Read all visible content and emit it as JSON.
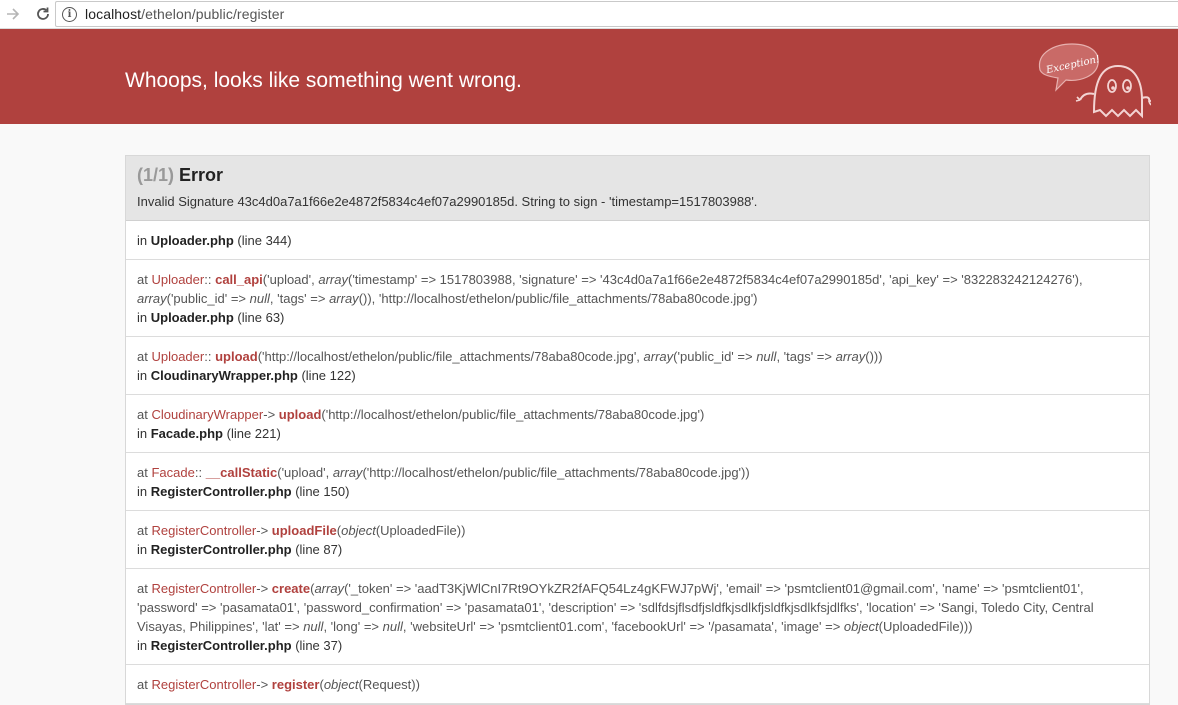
{
  "browser": {
    "url_host": "localhost",
    "url_path": "/ethelon/public/register"
  },
  "header": {
    "title": "Whoops, looks like something went wrong.",
    "logo_text": "Exception!"
  },
  "exception": {
    "count": "(1/1)",
    "type": "Error",
    "message": "Invalid Signature 43c4d0a7a1f66e2e4872f5834c4ef07a2990185d. String to sign - 'timestamp=1517803988'."
  },
  "trace": [
    {
      "file": "Uploader.php",
      "line": "(line 344)"
    },
    {
      "file": "Uploader.php",
      "line": "(line 63)"
    },
    {
      "file": "CloudinaryWrapper.php",
      "line": "(line 122)"
    },
    {
      "file": "Facade.php",
      "line": "(line 221)"
    },
    {
      "file": "RegisterController.php",
      "line": "(line 150)"
    },
    {
      "file": "RegisterController.php",
      "line": "(line 87)"
    },
    {
      "file": "RegisterController.php",
      "line": "(line 37)"
    }
  ],
  "calls": {
    "c1": {
      "cls": "Uploader",
      "sep": "::",
      "fn": "call_api"
    },
    "c2": {
      "cls": "Uploader",
      "sep": "::",
      "fn": "upload"
    },
    "c3": {
      "cls": "CloudinaryWrapper",
      "sep": "->",
      "fn": "upload"
    },
    "c4": {
      "cls": "Facade",
      "sep": "::",
      "fn": "__callStatic"
    },
    "c5": {
      "cls": "RegisterController",
      "sep": "->",
      "fn": "uploadFile"
    },
    "c6": {
      "cls": "RegisterController",
      "sep": "->",
      "fn": "create"
    },
    "c7": {
      "cls": "RegisterController",
      "sep": "->",
      "fn": "register"
    }
  },
  "args": {
    "c1a": "('upload', ",
    "c1b": "('timestamp' => 1517803988, 'signature' => '43c4d0a7a1f66e2e4872f5834c4ef07a2990185d', 'api_key' => '832283242124276'), ",
    "c1c": "('public_id' => ",
    "c1d": ", 'tags' => ",
    "c1e": "()), 'http://localhost/ethelon/public/file_attachments/78aba80code.jpg')",
    "c2a": "('http://localhost/ethelon/public/file_attachments/78aba80code.jpg', ",
    "c2b": "('public_id' => ",
    "c2c": ", 'tags' => ",
    "c2d": "()))",
    "c3a": "('http://localhost/ethelon/public/file_attachments/78aba80code.jpg')",
    "c4a": "('upload', ",
    "c4b": "('http://localhost/ethelon/public/file_attachments/78aba80code.jpg'))",
    "c5a": "(",
    "c5b": "(UploadedFile))",
    "c6a": "(",
    "c6b": "('_token' => 'aadT3KjWlCnI7Rt9OYkZR2fAFQ54Lz4gKFWJ7pWj', 'email' => 'psmtclient01@gmail.com', 'name' => 'psmtclient01', 'password' => 'pasamata01', 'password_confirmation' => 'pasamata01', 'description' => 'sdlfdsjflsdfjsldfkjsdlkfjsldfkjsdlkfsjdlfks', 'location' => 'Sangi, Toledo City, Central Visayas, Philippines', 'lat' => ",
    "c6c": ", 'long' => ",
    "c6d": ", 'websiteUrl' => 'psmtclient01.com', 'facebookUrl' => '/pasamata', 'image' => ",
    "c6e": "(UploadedFile)))",
    "c7a": "(",
    "c7b": "(Request))"
  },
  "words": {
    "at": "at ",
    "in": "in ",
    "array": "array",
    "null": "null",
    "object": "object"
  }
}
